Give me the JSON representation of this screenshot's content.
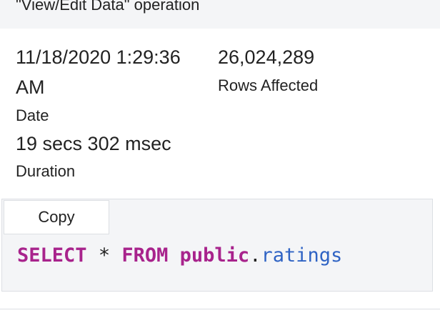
{
  "header": {
    "title": "\"View/Edit Data\" operation"
  },
  "stats": {
    "date_value": "11/18/2020 1:29:36 AM",
    "date_label": "Date",
    "duration_value": "19 secs 302 msec",
    "duration_label": "Duration",
    "rows_value": "26,024,289",
    "rows_label": "Rows Affected"
  },
  "sql_panel": {
    "copy_label": "Copy",
    "tokens": {
      "select": "SELECT",
      "star": "*",
      "from": "FROM",
      "schema": "public",
      "dot": ".",
      "table": "ratings"
    }
  },
  "colors": {
    "keyword": "#a8238c",
    "identifier": "#2f63c4",
    "panel_background": "#f4f5f7",
    "border": "#dcdfe3"
  }
}
